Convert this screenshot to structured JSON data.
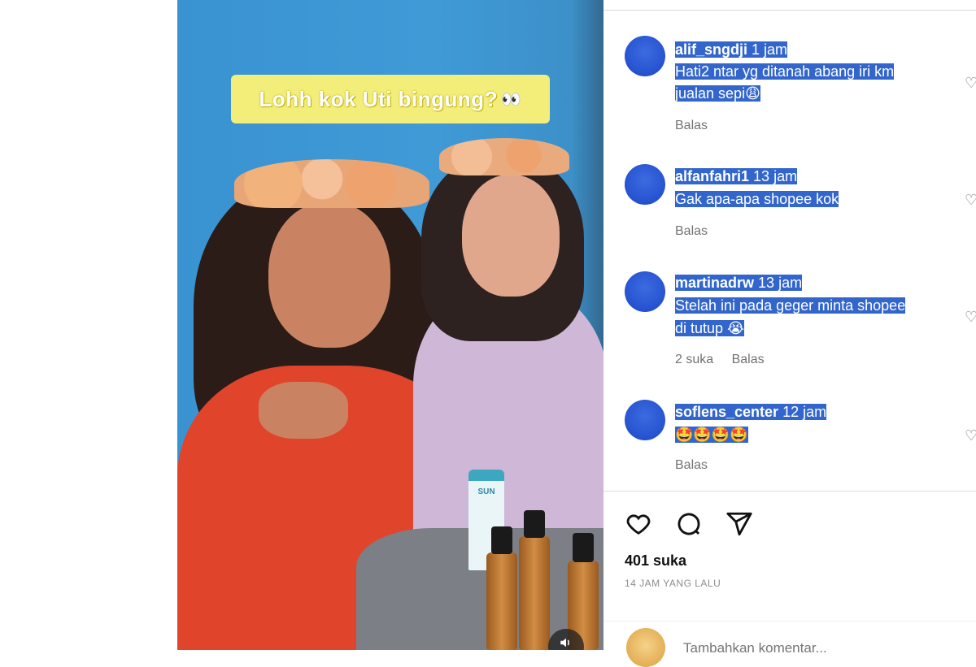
{
  "video": {
    "caption_text": "Lohh kok Uti bingung?",
    "caption_emoji": "👀",
    "product_label": "SUN",
    "mute_icon": "speaker-icon"
  },
  "comments": [
    {
      "username": "alif_sngdji",
      "time": "1 jam",
      "lines": [
        "Hati2 ntar yg ditanah abang iri km",
        "jualan sepi😩"
      ],
      "likes": "",
      "reply": "Balas"
    },
    {
      "username": "alfanfahri1",
      "time": "13 jam",
      "lines": [
        "Gak apa-apa shopee kok"
      ],
      "likes": "",
      "reply": "Balas"
    },
    {
      "username": "martinadrw",
      "time": "13 jam",
      "lines": [
        "Stelah ini pada geger minta shopee",
        "di tutup 😭"
      ],
      "likes": "2 suka",
      "reply": "Balas"
    },
    {
      "username": "soflens_center",
      "time": "12 jam",
      "lines": [
        "🤩🤩🤩🤩"
      ],
      "likes": "",
      "reply": "Balas"
    }
  ],
  "post": {
    "likes": "401 suka",
    "time_ago": "14 JAM YANG LALU",
    "add_comment_placeholder": "Tambahkan komentar..."
  },
  "colors": {
    "selection": "#3366cc",
    "caption_bg": "#f3ee7a",
    "video_bg": "#3f9ad6"
  }
}
